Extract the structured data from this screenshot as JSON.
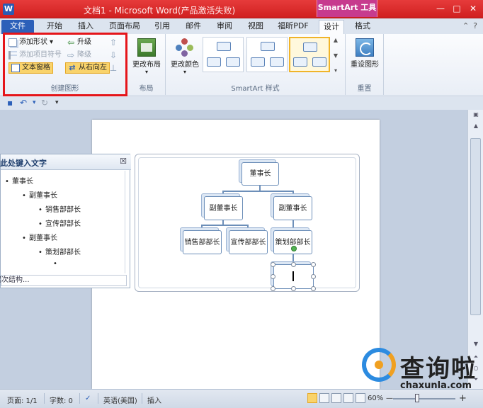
{
  "titlebar": {
    "app_icon": "W",
    "title": "文档1 - Microsoft Word(产品激活失败)",
    "context_tools": "SmartArt 工具",
    "min": "—",
    "max": "□",
    "close": "✕"
  },
  "tabs": {
    "file": "文件",
    "items": [
      "开始",
      "插入",
      "页面布局",
      "引用",
      "邮件",
      "审阅",
      "视图",
      "福昕PDF",
      "设计",
      "格式"
    ],
    "help": "?"
  },
  "ribbon": {
    "create": {
      "add_shape": "添加形状",
      "upgrade": "升级",
      "add_bullet": "添加项目符号",
      "downgrade": "降级",
      "text_pane": "文本窗格",
      "rtl": "从右向左",
      "label": "创建图形"
    },
    "layout": {
      "change_layout": "更改布局",
      "label": "布局"
    },
    "styles": {
      "change_colors": "更改颜色",
      "label": "SmartArt 样式"
    },
    "reset": {
      "reset_graphic": "重设图形",
      "label": "重置"
    }
  },
  "textpane": {
    "title": "在此处键入文字",
    "close": "☒",
    "items": [
      {
        "level": 1,
        "text": "董事长"
      },
      {
        "level": 2,
        "text": "副董事长"
      },
      {
        "level": 3,
        "text": "销售部部长"
      },
      {
        "level": 3,
        "text": "宣传部部长"
      },
      {
        "level": 2,
        "text": "副董事长"
      },
      {
        "level": 3,
        "text": "策划部部长"
      },
      {
        "level": 3,
        "text": ""
      }
    ],
    "footer": "层次结构..."
  },
  "smartart": {
    "root": "董事长",
    "vp_left": "副董事长",
    "vp_right": "副董事长",
    "sales": "销售部部长",
    "promo": "宣传部部长",
    "planning": "策划部部长",
    "new_text": ""
  },
  "statusbar": {
    "page": "页面: 1/1",
    "words": "字数: 0",
    "language": "英语(美国)",
    "mode": "插入",
    "zoom": "60%",
    "zoom_out": "—",
    "zoom_in": "+"
  },
  "watermark": {
    "text": "查询啦",
    "url": "chaxunla.com"
  },
  "colors": {
    "title_red": "#d01f1f",
    "smartart_tab": "#c73b8e",
    "highlight_red": "#e5151a",
    "node_border": "#6d8fb9"
  }
}
